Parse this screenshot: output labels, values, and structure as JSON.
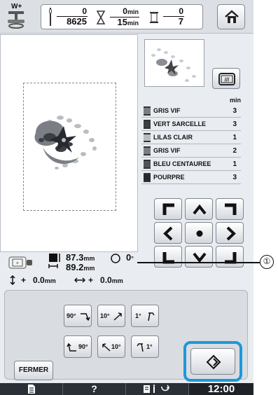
{
  "header": {
    "presser_foot_label": "W+",
    "stitches_done": "0",
    "stitches_total": "8625",
    "time_done": "0",
    "time_total": "15",
    "time_unit": "min",
    "colors_done": "0",
    "colors_total": "7"
  },
  "thread_list": {
    "min_header": "min",
    "rows": [
      {
        "name": "GRIS VIF",
        "count": "3",
        "color": "#7b7f85"
      },
      {
        "name": "VERT SARCELLE",
        "count": "3",
        "color": "#3a3f44"
      },
      {
        "name": "LILAS CLAIR",
        "count": "1",
        "color": "#b9bcc0"
      },
      {
        "name": "GRIS VIF",
        "count": "2",
        "color": "#7b7f85"
      },
      {
        "name": "BLEU CENTAUREE",
        "count": "1",
        "color": "#505559"
      },
      {
        "name": "POURPRE",
        "count": "3",
        "color": "#262a2e"
      }
    ]
  },
  "info": {
    "height_value": "87.3",
    "width_value": "89.2",
    "size_unit": "mm",
    "angle_value": "0",
    "angle_unit": "°",
    "vertical_offset": "0.0",
    "horizontal_offset": "0.0",
    "offset_unit": "mm",
    "plus_sign": "+"
  },
  "rotation_buttons": {
    "cw_90": "90°",
    "cw_10": "10°",
    "cw_1": "1°",
    "ccw_90": "90°",
    "ccw_10": "10°",
    "ccw_1": "1°"
  },
  "close_label": "FERMER",
  "callout_number": "①",
  "status": {
    "help_label": "?",
    "clock": "12:00"
  },
  "colors": {
    "accent": "#1e98d8",
    "status_bar": "#2b2f36"
  }
}
